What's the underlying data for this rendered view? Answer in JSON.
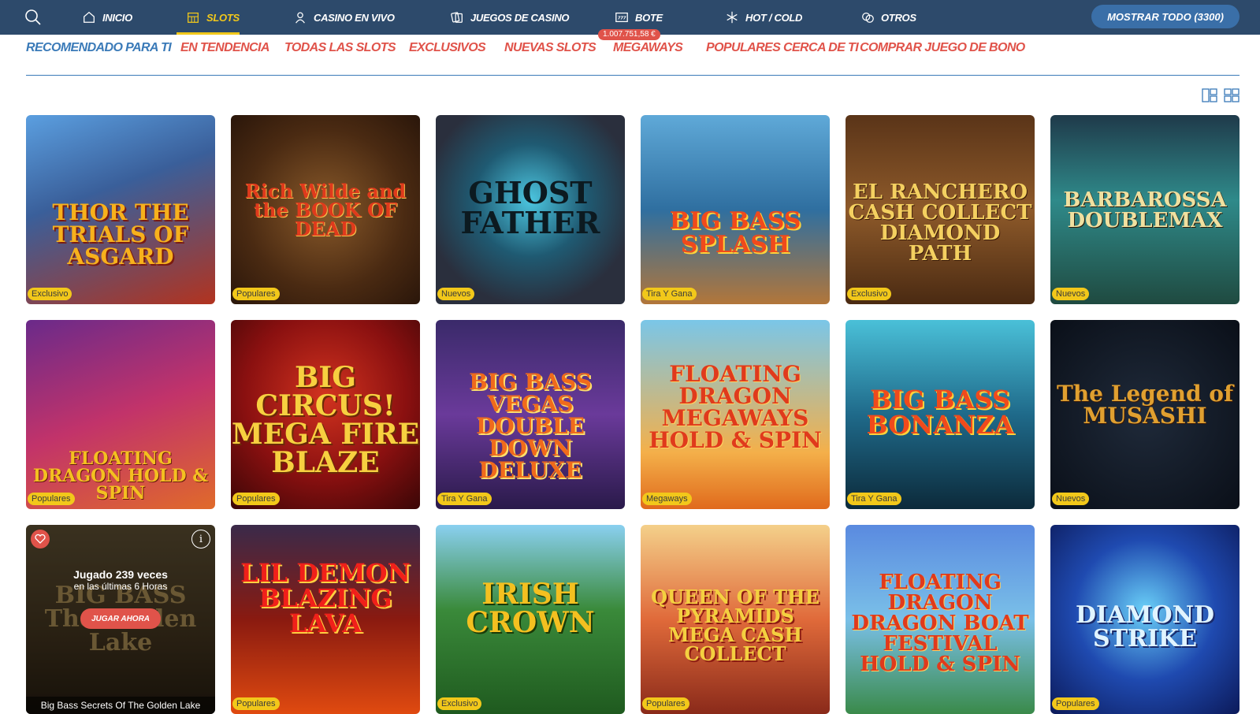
{
  "nav": {
    "items": [
      {
        "label": "INICIO",
        "icon": "home-icon"
      },
      {
        "label": "SLOTS",
        "icon": "slot-machine-icon"
      },
      {
        "label": "CASINO EN VIVO",
        "icon": "dealer-icon"
      },
      {
        "label": "JUEGOS DE CASINO",
        "icon": "cards-icon"
      },
      {
        "label": "BOTE",
        "icon": "jackpot-icon"
      },
      {
        "label": "HOT / COLD",
        "icon": "snowflake-icon"
      },
      {
        "label": "OTROS",
        "icon": "chips-icon"
      }
    ],
    "active": "SLOTS",
    "show_all": "MOSTRAR TODO (3300)"
  },
  "subtabs": [
    "RECOMENDADO PARA TI",
    "EN TENDENCIA",
    "TODAS LAS SLOTS",
    "EXCLUSIVOS",
    "NUEVAS SLOTS",
    "MEGAWAYS",
    "POPULARES CERCA DE TI",
    "COMPRAR JUEGO DE BONO"
  ],
  "jackpot_amount": "1.007.751,58 €",
  "games": [
    {
      "title": "THOR THE TRIALS OF ASGARD",
      "badge": "Exclusivo"
    },
    {
      "title": "Rich Wilde and the BOOK OF DEAD",
      "badge": "Populares"
    },
    {
      "title": "GHOST FATHER",
      "badge": "Nuevos"
    },
    {
      "title": "BIG BASS SPLASH",
      "badge": "Tira Y Gana"
    },
    {
      "title": "EL RANCHERO CASH COLLECT DIAMOND PATH",
      "badge": "Exclusivo"
    },
    {
      "title": "BARBAROSSA DOUBLEMAX",
      "badge": "Nuevos"
    },
    {
      "title": "FLOATING DRAGON HOLD & SPIN",
      "badge": "Populares"
    },
    {
      "title": "BIG CIRCUS! MEGA FIRE BLAZE",
      "badge": "Populares"
    },
    {
      "title": "BIG BASS VEGAS DOUBLE DOWN DELUXE",
      "badge": "Tira Y Gana"
    },
    {
      "title": "FLOATING DRAGON MEGAWAYS HOLD & SPIN",
      "badge": "Megaways"
    },
    {
      "title": "BIG BASS BONANZA",
      "badge": "Tira Y Gana"
    },
    {
      "title": "The Legend of MUSASHI",
      "badge": "Nuevos"
    },
    {
      "title": "BIG BASS The Golden Lake",
      "badge": ""
    },
    {
      "title": "LIL DEMON BLAZING LAVA",
      "badge": "Populares"
    },
    {
      "title": "IRISH CROWN",
      "badge": "Exclusivo"
    },
    {
      "title": "QUEEN OF THE PYRAMIDS MEGA CASH COLLECT",
      "badge": "Populares"
    },
    {
      "title": "FLOATING DRAGON DRAGON BOAT FESTIVAL HOLD & SPIN",
      "badge": ""
    },
    {
      "title": "DIAMOND STRIKE",
      "badge": "Populares"
    }
  ],
  "hover_card": {
    "played": "Jugado 239 veces",
    "played_sub": "en las últimas 6 Horas",
    "play_now": "JUGAR AHORA",
    "name": "Big Bass Secrets Of The Golden Lake"
  },
  "colors": {
    "nav_bg": "#2d4a6b",
    "active_nav": "#f2c81a",
    "tab_red": "#e0534a",
    "tab_active_blue": "#3a7ab8",
    "badge_yellow": "#f2c81a"
  }
}
